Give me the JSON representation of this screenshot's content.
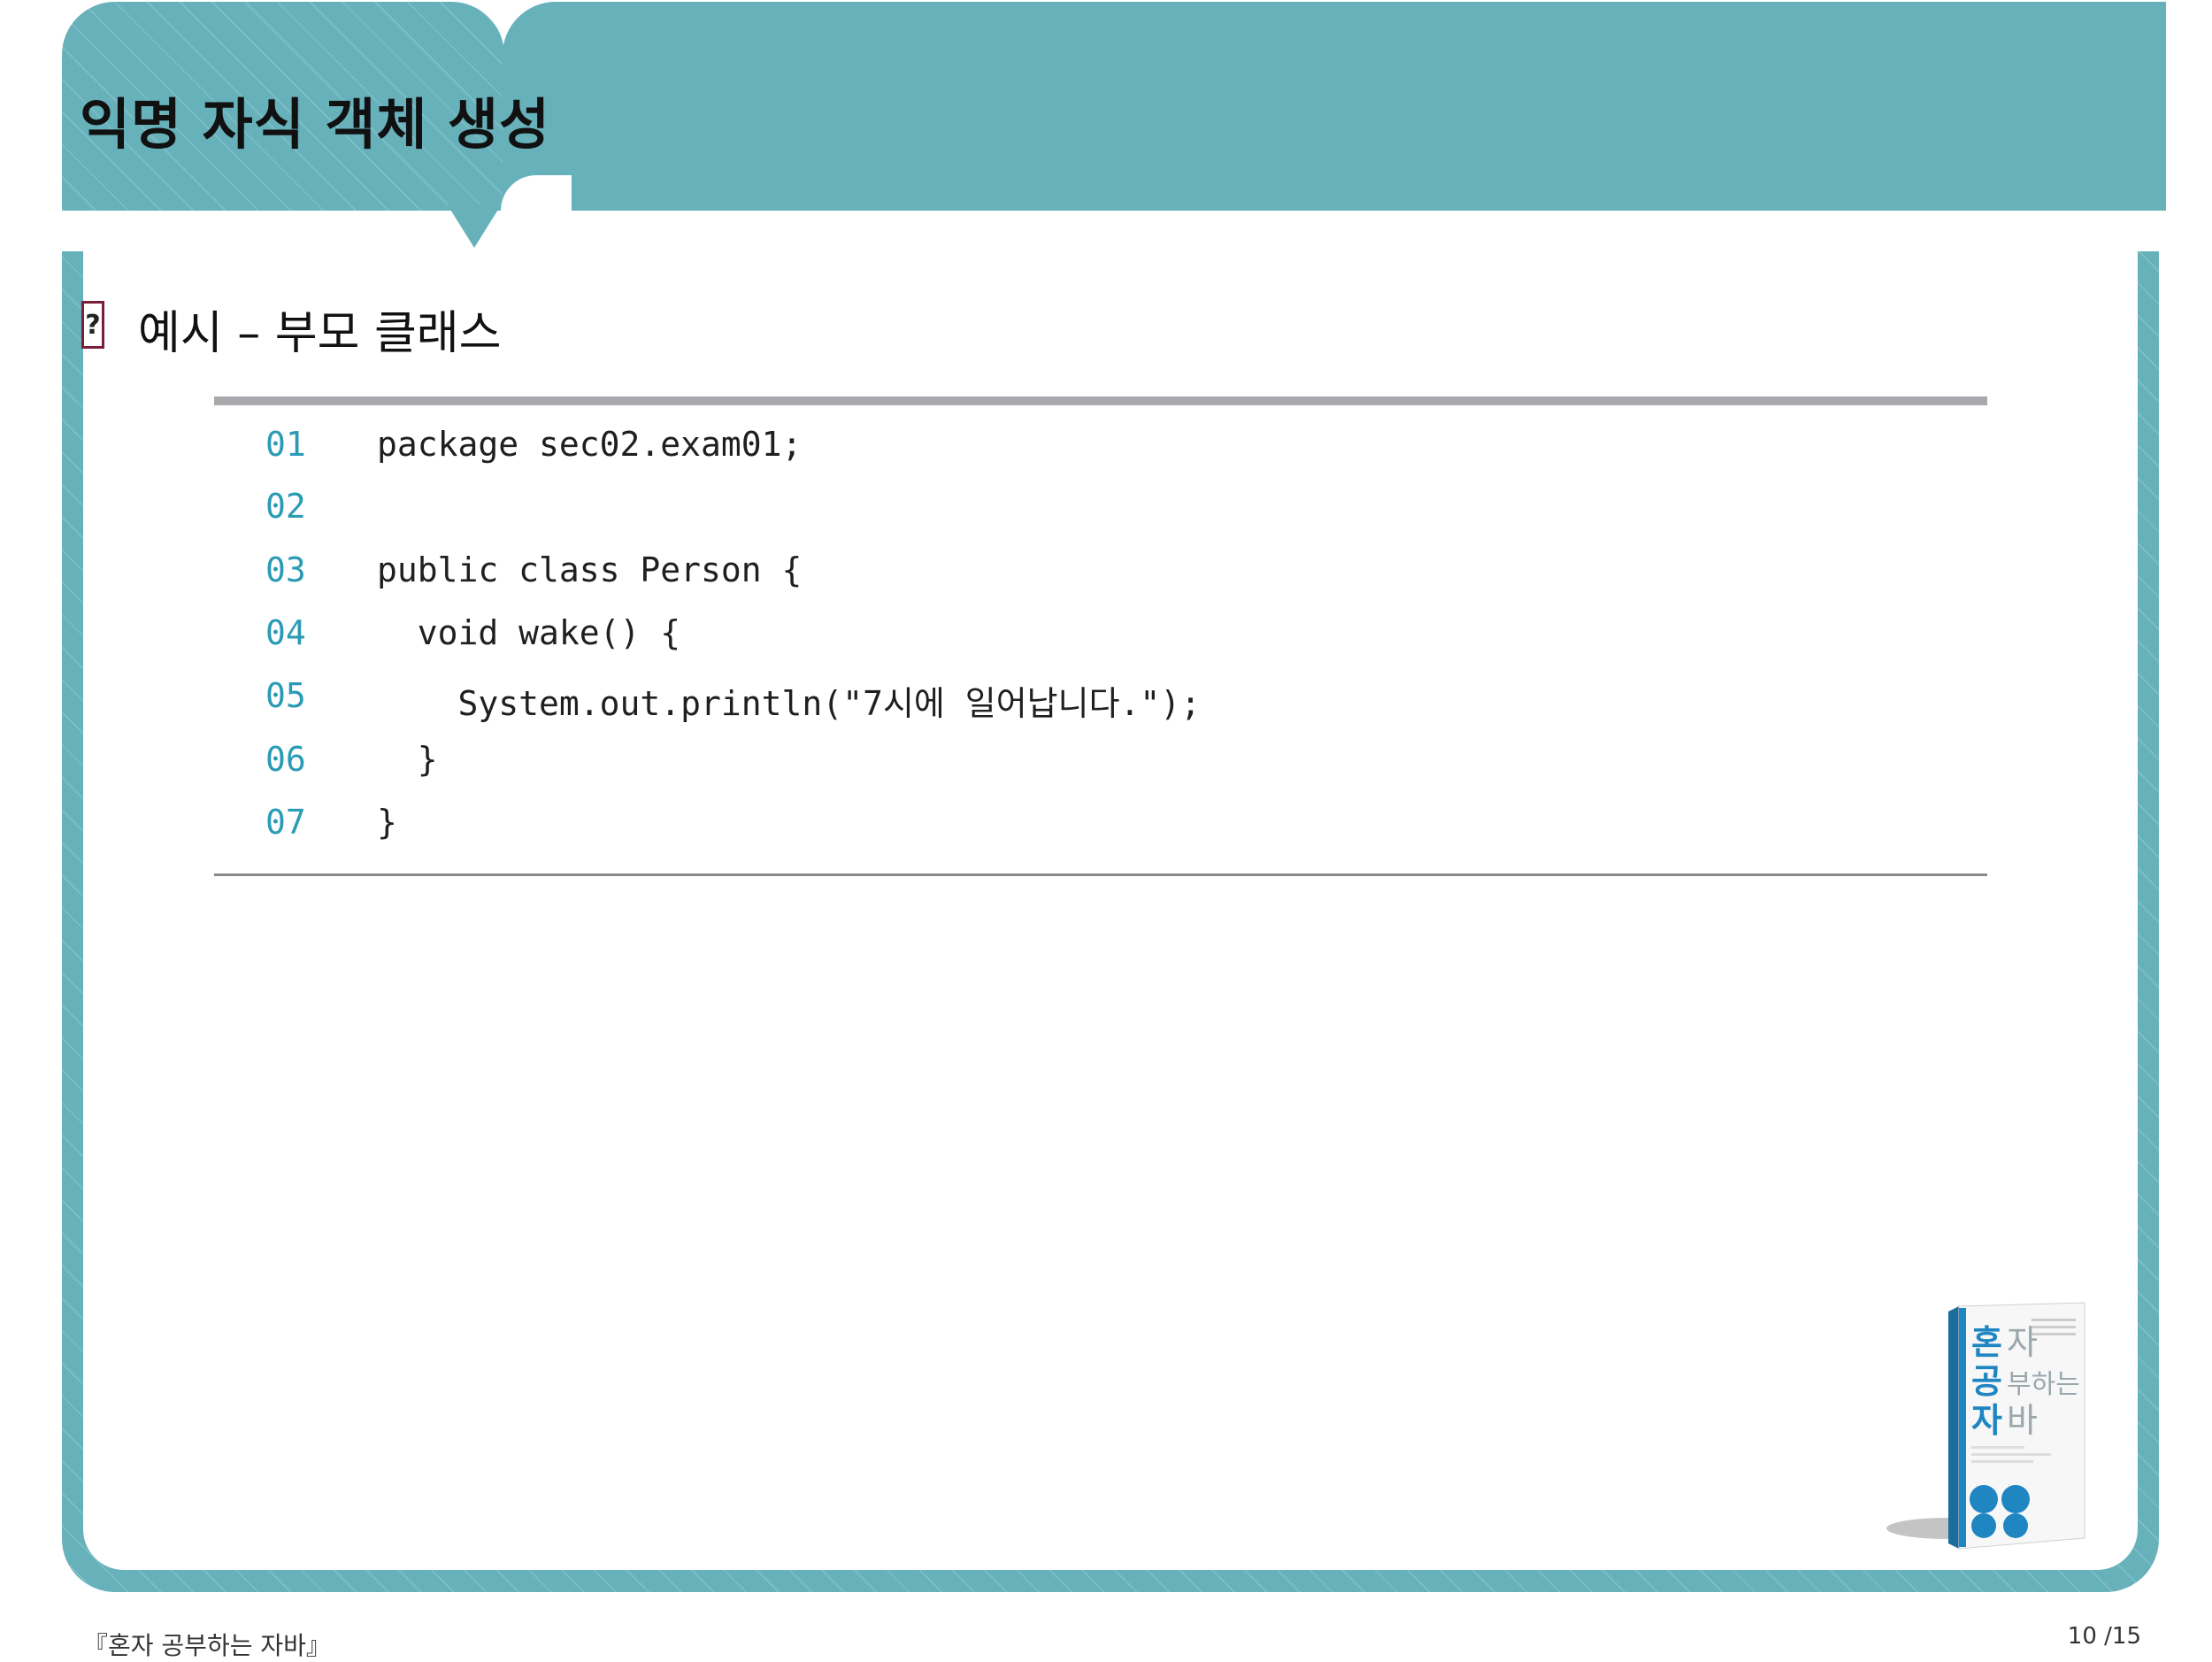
{
  "header": {
    "title": "익명 자식 객체 생성"
  },
  "section": {
    "icon": "question-box-icon",
    "icon_glyph": "?",
    "heading": "예시 – 부모 클래스"
  },
  "code": {
    "lines": [
      {
        "num": "01",
        "text": "package sec02.exam01;"
      },
      {
        "num": "02",
        "text": ""
      },
      {
        "num": "03",
        "text": "public class Person {"
      },
      {
        "num": "04",
        "text": "  void wake() {"
      },
      {
        "num": "05",
        "text": "    System.out.println(\"7시에 일어납니다.\");"
      },
      {
        "num": "06",
        "text": "  }"
      },
      {
        "num": "07",
        "text": "}"
      }
    ]
  },
  "book": {
    "icon": "book-cover-image",
    "title_chars": [
      "혼",
      "자",
      "공",
      "부하는",
      "자",
      "바"
    ]
  },
  "footer": {
    "book_title": "『혼자 공부하는 자바』",
    "page": "10 /15"
  },
  "colors": {
    "accent": "#67b1bb",
    "icon_border": "#7a1f3a",
    "line_number": "#2a9bb5"
  }
}
